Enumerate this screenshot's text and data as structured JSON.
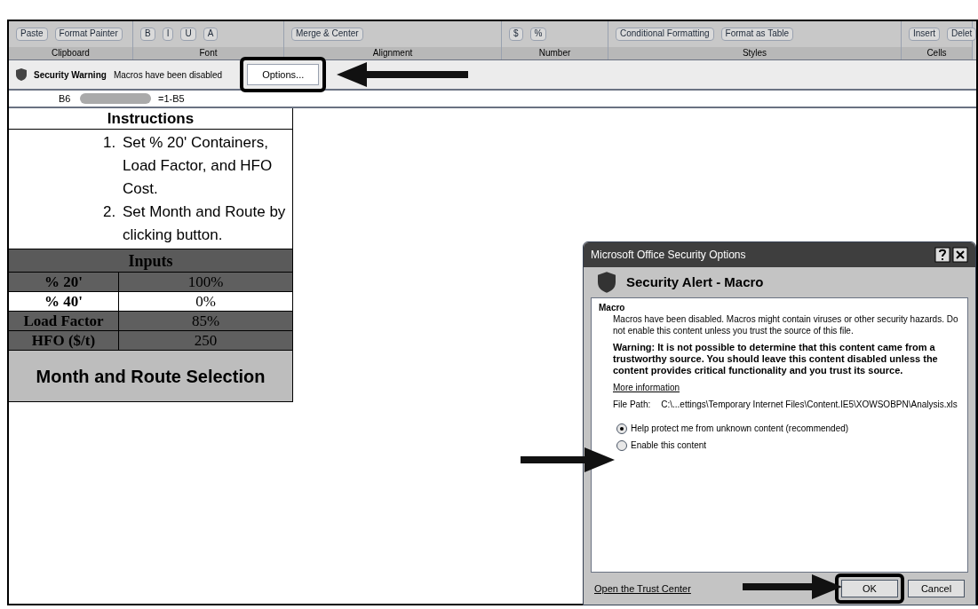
{
  "ribbon": {
    "groups": [
      {
        "label": "Clipboard",
        "items": [
          "Paste",
          "Format Painter"
        ]
      },
      {
        "label": "Font",
        "items": [
          "B",
          "I",
          "U",
          "A"
        ]
      },
      {
        "label": "Alignment",
        "items": [
          "Merge & Center"
        ]
      },
      {
        "label": "Number",
        "items": [
          "$",
          "%"
        ]
      },
      {
        "label": "Styles",
        "items": [
          "Conditional Formatting",
          "Format as Table"
        ]
      },
      {
        "label": "Cells",
        "items": [
          "Insert",
          "Delet"
        ]
      }
    ]
  },
  "security_bar": {
    "label": "Security Warning",
    "message": "Macros have been disabled",
    "button": "Options..."
  },
  "formula_bar": {
    "name_box": "B6",
    "formula": "=1-B5"
  },
  "sheet": {
    "instructions_title": "Instructions",
    "steps": [
      {
        "number": "1.",
        "text": "Set % 20' Containers, Load Factor, and HFO Cost."
      },
      {
        "number": "2.",
        "text": "Set Month and Route by clicking button."
      }
    ],
    "inputs_title": "Inputs",
    "inputs": [
      {
        "label": "% 20'",
        "value": "100%",
        "shaded": true
      },
      {
        "label": "% 40'",
        "value": "0%",
        "shaded": false
      },
      {
        "label": "Load Factor",
        "value": "85%",
        "shaded": true
      },
      {
        "label": "HFO ($/t)",
        "value": "250",
        "shaded": true
      }
    ],
    "button": "Month and Route Selection"
  },
  "dialog": {
    "title": "Microsoft Office Security Options",
    "heading": "Security Alert - Macro",
    "section": "Macro",
    "paragraph": "Macros have been disabled. Macros might contain viruses or other security hazards. Do not enable this content unless you trust the source of this file.",
    "warning": "Warning: It is not possible to determine that this content came from a trustworthy source. You should leave this content disabled unless the content provides critical functionality and you trust its source.",
    "more_link": "More information",
    "file_path_label": "File Path:",
    "file_path": "C:\\...ettings\\Temporary Internet Files\\Content.IE5\\XOWSOBPN\\Analysis.xls",
    "options": [
      {
        "label": "Help protect me from unknown content (recommended)",
        "selected": true
      },
      {
        "label": "Enable this content",
        "selected": false
      }
    ],
    "trust_link": "Open the Trust Center",
    "buttons": [
      "OK",
      "Cancel"
    ]
  }
}
